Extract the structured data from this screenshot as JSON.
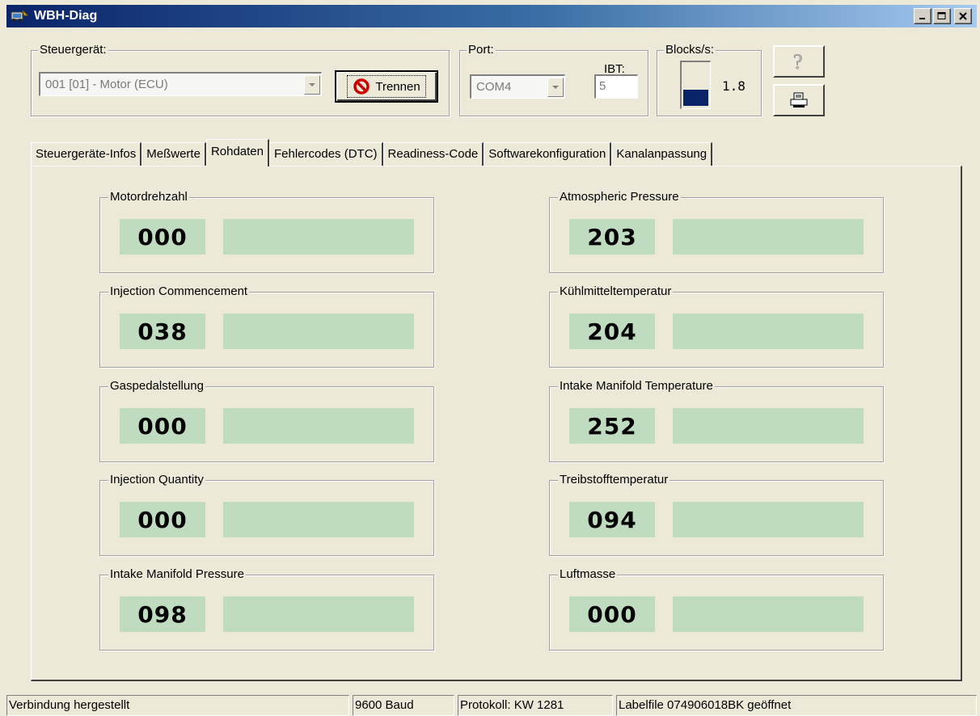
{
  "window": {
    "title": "WBH-Diag",
    "icon": "car-diagnostic-icon"
  },
  "steuergeraet": {
    "label": "Steuergerät:",
    "selected": "001 [01] - Motor (ECU)",
    "disconnect_label": "Trennen",
    "disconnect_icon": "stop-icon"
  },
  "port": {
    "label": "Port:",
    "selected": "COM4",
    "ibt_label": "IBT:",
    "ibt_value": "5"
  },
  "blocks": {
    "label": "Blocks/s:",
    "value": "1.8"
  },
  "toolbar": {
    "help_icon": "question-icon",
    "print_icon": "printer-icon"
  },
  "tabs": [
    {
      "label": "Steuergeräte-Infos"
    },
    {
      "label": "Meßwerte"
    },
    {
      "label": "Rohdaten",
      "active": true
    },
    {
      "label": "Fehlercodes (DTC)"
    },
    {
      "label": "Readiness-Code"
    },
    {
      "label": "Softwarekonfiguration"
    },
    {
      "label": "Kanalanpassung"
    }
  ],
  "channels_left": [
    {
      "label": "Motordrehzahl",
      "value": "000"
    },
    {
      "label": "Injection Commencement",
      "value": "038"
    },
    {
      "label": "Gaspedalstellung",
      "value": "000"
    },
    {
      "label": "Injection Quantity",
      "value": "000"
    },
    {
      "label": "Intake Manifold Pressure",
      "value": "098"
    }
  ],
  "channels_right": [
    {
      "label": "Atmospheric Pressure",
      "value": "203"
    },
    {
      "label": "Kühlmitteltemperatur",
      "value": "204"
    },
    {
      "label": "Intake Manifold Temperature",
      "value": "252"
    },
    {
      "label": "Treibstofftemperatur",
      "value": "094"
    },
    {
      "label": "Luftmasse",
      "value": "000"
    }
  ],
  "status": {
    "connection": "Verbindung hergestellt",
    "baud": "9600 Baud",
    "protocol": "Protokoll: KW 1281",
    "labelfile": "Labelfile 074906018BK geöffnet"
  },
  "colors": {
    "titlebar": "#0a246a",
    "value_bg": "#c0dcc0",
    "blocks_fill": "#0a246a",
    "stop_red": "#cc0000"
  }
}
